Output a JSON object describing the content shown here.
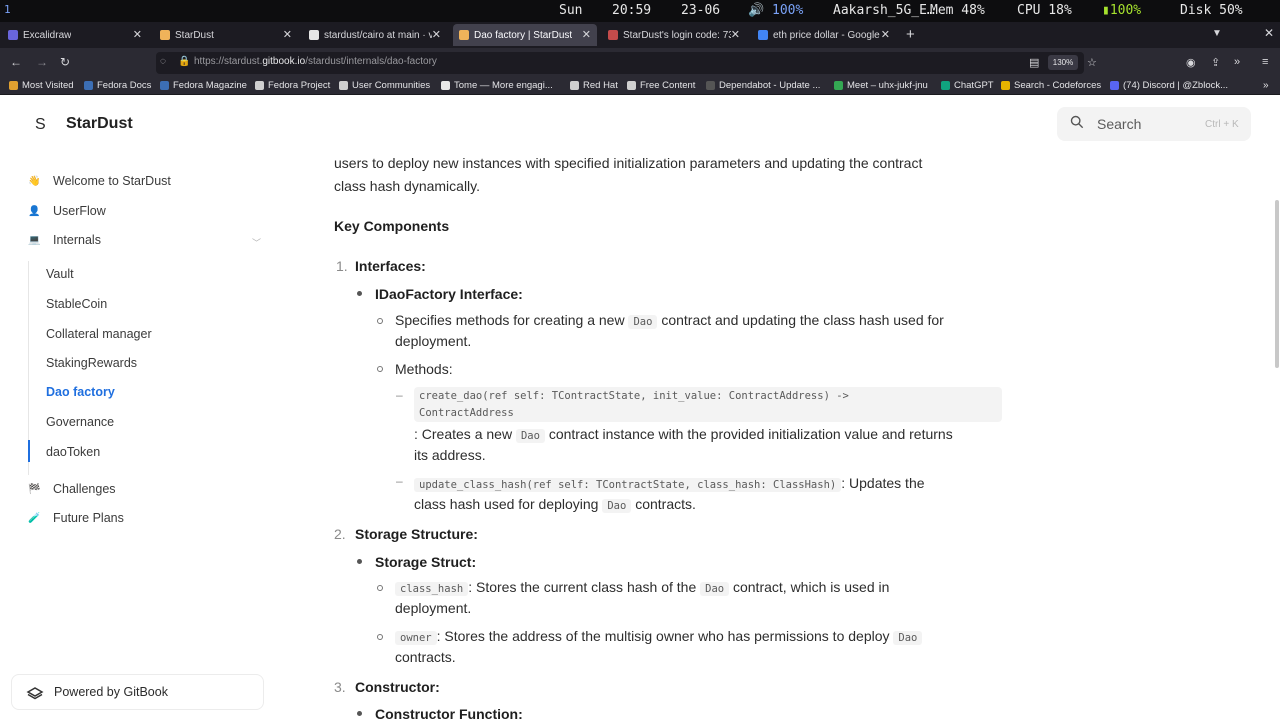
{
  "system_bar": {
    "workspace": "1",
    "day": "Sun",
    "time": "20:59",
    "date": "23-06",
    "volume": "🔊 100%",
    "wifi": "Aakarsh_5G_E…",
    "memory": "Mem 48%",
    "cpu": "CPU 18%",
    "battery": "100%",
    "disk": "Disk 50%"
  },
  "tabs": [
    {
      "label": "Excalidraw",
      "color": "#6965db",
      "active": false
    },
    {
      "label": "StarDust",
      "color": "#f0b35a",
      "active": false
    },
    {
      "label": "stardust/cairo at main · vi",
      "color": "#e6e6e6",
      "active": false
    },
    {
      "label": "Dao factory | StarDust",
      "color": "#f0b35a",
      "active": true
    },
    {
      "label": "StarDust's login code: 73:",
      "color": "#c44b4b",
      "active": false
    },
    {
      "label": "eth price dollar - Google S",
      "color": "#4285f4",
      "active": false
    }
  ],
  "nav": {
    "url_prefix": "https://stardust.",
    "url_domain": "gitbook.io",
    "url_path": "/stardust/internals/dao-factory",
    "zoom": "130%"
  },
  "bookmarks": [
    {
      "label": "Most Visited",
      "color": "#e0a030"
    },
    {
      "label": "Fedora Docs",
      "color": "#3c6eb4"
    },
    {
      "label": "Fedora Magazine",
      "color": "#3c6eb4"
    },
    {
      "label": "Fedora Project",
      "color": "#cfcfcf"
    },
    {
      "label": "User Communities",
      "color": "#cfcfcf"
    },
    {
      "label": "Tome — More engagi...",
      "color": "#e8e8e8"
    },
    {
      "label": "Red Hat",
      "color": "#cfcfcf"
    },
    {
      "label": "Free Content",
      "color": "#cfcfcf"
    },
    {
      "label": "Dependabot - Update ...",
      "color": "#555"
    },
    {
      "label": "Meet – uhx-jukf-jnu",
      "color": "#34a853"
    },
    {
      "label": "ChatGPT",
      "color": "#10a37f"
    },
    {
      "label": "Search - Codeforces",
      "color": "#e6b400"
    },
    {
      "label": "(74) Discord | @Zblock...",
      "color": "#5865f2"
    }
  ],
  "header": {
    "brand": "StarDust",
    "logo_letter": "S",
    "search_placeholder": "Search",
    "search_shortcut": "Ctrl + K"
  },
  "sidebar": {
    "items": [
      {
        "label": "Welcome to StarDust",
        "icon": "👋"
      },
      {
        "label": "UserFlow",
        "icon": "👤"
      },
      {
        "label": "Internals",
        "icon": "💻"
      }
    ],
    "sub_items": [
      {
        "label": "Vault"
      },
      {
        "label": "StableCoin"
      },
      {
        "label": "Collateral manager"
      },
      {
        "label": "StakingRewards"
      },
      {
        "label": "Dao factory"
      },
      {
        "label": "Governance"
      },
      {
        "label": "daoToken"
      }
    ],
    "bottom_items": [
      {
        "label": "Challenges",
        "icon": "🏁"
      },
      {
        "label": "Future Plans",
        "icon": "🧪"
      }
    ],
    "powered_by": "Powered by GitBook"
  },
  "content": {
    "intro_line1": "users to deploy new instances with specified initialization parameters and updating the contract",
    "intro_line2": "class hash dynamically.",
    "key_components": "Key Components",
    "s1_num": "1.",
    "s1_title": "Interfaces:",
    "s1_sub_title": "IDaoFactory Interface:",
    "s1_desc_a": "Specifies methods for creating a new",
    "s1_desc_code": "Dao",
    "s1_desc_b": "contract and updating the class hash used for",
    "s1_desc_c": "deployment.",
    "methods_label": "Methods:",
    "m1_code_line1": "create_dao(ref self: TContractState, init_value: ContractAddress) ->",
    "m1_code_line2": "ContractAddress",
    "m1_desc_a": ": Creates a new",
    "m1_desc_code": "Dao",
    "m1_desc_b": "contract instance with the provided initialization value and returns",
    "m1_desc_c": "its address.",
    "m2_code": "update_class_hash(ref self: TContractState, class_hash: ClassHash)",
    "m2_desc_a": ": Updates the",
    "m2_desc_b": "class hash used for deploying",
    "m2_desc_code": "Dao",
    "m2_desc_c": "contracts.",
    "s2_num": "2.",
    "s2_title": "Storage Structure:",
    "s2_sub_title": "Storage Struct:",
    "f1_code": "class_hash",
    "f1_desc_a": ": Stores the current class hash of the",
    "f1_desc_code": "Dao",
    "f1_desc_b": "contract, which is used in",
    "f1_desc_c": "deployment.",
    "f2_code": "owner",
    "f2_desc_a": ": Stores the address of the multisig owner who has permissions to deploy",
    "f2_desc_code": "Dao",
    "f2_desc_b": "contracts.",
    "s3_num": "3.",
    "s3_title": "Constructor:",
    "s3_sub_title": "Constructor Function:"
  }
}
